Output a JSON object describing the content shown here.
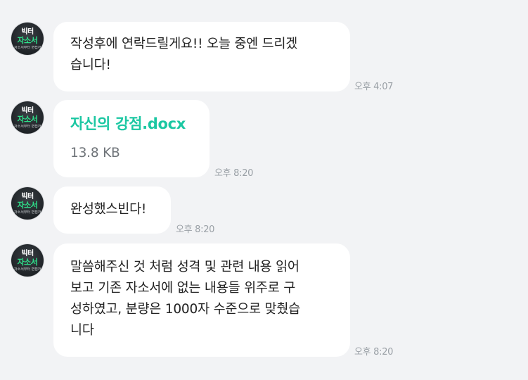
{
  "avatar": {
    "line1": "빅터",
    "line2": "자소서",
    "line3": "자소서부터 면접까지"
  },
  "messages": [
    {
      "type": "text",
      "lines": [
        "작성후에 연락드릴게요!! 오늘 중엔 드리겠",
        "습니다!"
      ],
      "time": "오후 4:07"
    },
    {
      "type": "file",
      "file_name": "자신의 강점.docx",
      "file_size": "13.8 KB",
      "time": "오후 8:20"
    },
    {
      "type": "text",
      "lines": [
        "완성했스빈다!"
      ],
      "time": "오후 8:20"
    },
    {
      "type": "text",
      "lines": [
        "말씀해주신 것 처럼 성격 및 관련 내용 읽어",
        "보고 기존 자소서에 없는 내용들 위주로 구",
        "성하였고, 분량은 1000자 수준으로 맞췄습",
        "니다"
      ],
      "time": "오후 8:20"
    }
  ]
}
